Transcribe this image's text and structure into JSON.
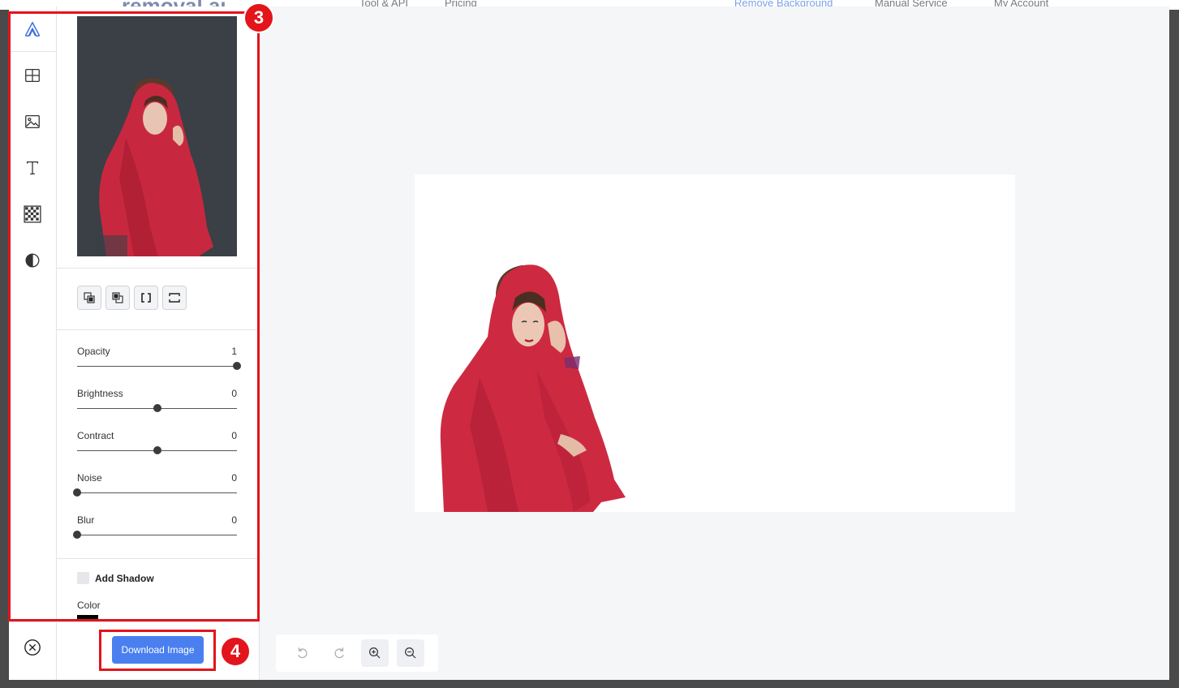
{
  "site_header": {
    "logo_text": "removal.ai",
    "nav_items": [
      "Tool & API",
      "Pricing",
      "Remove Background",
      "Manual Service",
      "My Account"
    ]
  },
  "toolbar": {
    "tools": [
      {
        "name": "logo",
        "icon": "app-logo-icon"
      },
      {
        "name": "layout",
        "icon": "grid-icon"
      },
      {
        "name": "background-image",
        "icon": "image-icon"
      },
      {
        "name": "text",
        "icon": "text-icon"
      },
      {
        "name": "transparency",
        "icon": "checkerboard-icon"
      },
      {
        "name": "adjust",
        "icon": "contrast-icon"
      }
    ],
    "close_icon": "close-circle-icon"
  },
  "panel": {
    "arrange_buttons": [
      "bring-forward-icon",
      "send-backward-icon",
      "bracket-fit-icon",
      "stretch-fit-icon"
    ],
    "sliders": [
      {
        "label": "Opacity",
        "value": "1",
        "fraction": 1.0
      },
      {
        "label": "Brightness",
        "value": "0",
        "fraction": 0.5
      },
      {
        "label": "Contract",
        "value": "0",
        "fraction": 0.5
      },
      {
        "label": "Noise",
        "value": "0",
        "fraction": 0.0
      },
      {
        "label": "Blur",
        "value": "0",
        "fraction": 0.0
      }
    ],
    "add_shadow_label": "Add Shadow",
    "add_shadow_checked": false,
    "color_label": "Color",
    "shadow_color": "#000000",
    "download_label": "Download Image"
  },
  "canvas_controls": [
    "undo-icon",
    "redo-icon",
    "zoom-in-icon",
    "zoom-out-icon"
  ],
  "annotations": {
    "badge_3": "3",
    "badge_4": "4",
    "color": "#e3141b"
  },
  "colors": {
    "accent": "#4a7ff0",
    "thumbnail_bg": "#3b3f46",
    "scarf_red": "#d42640"
  }
}
